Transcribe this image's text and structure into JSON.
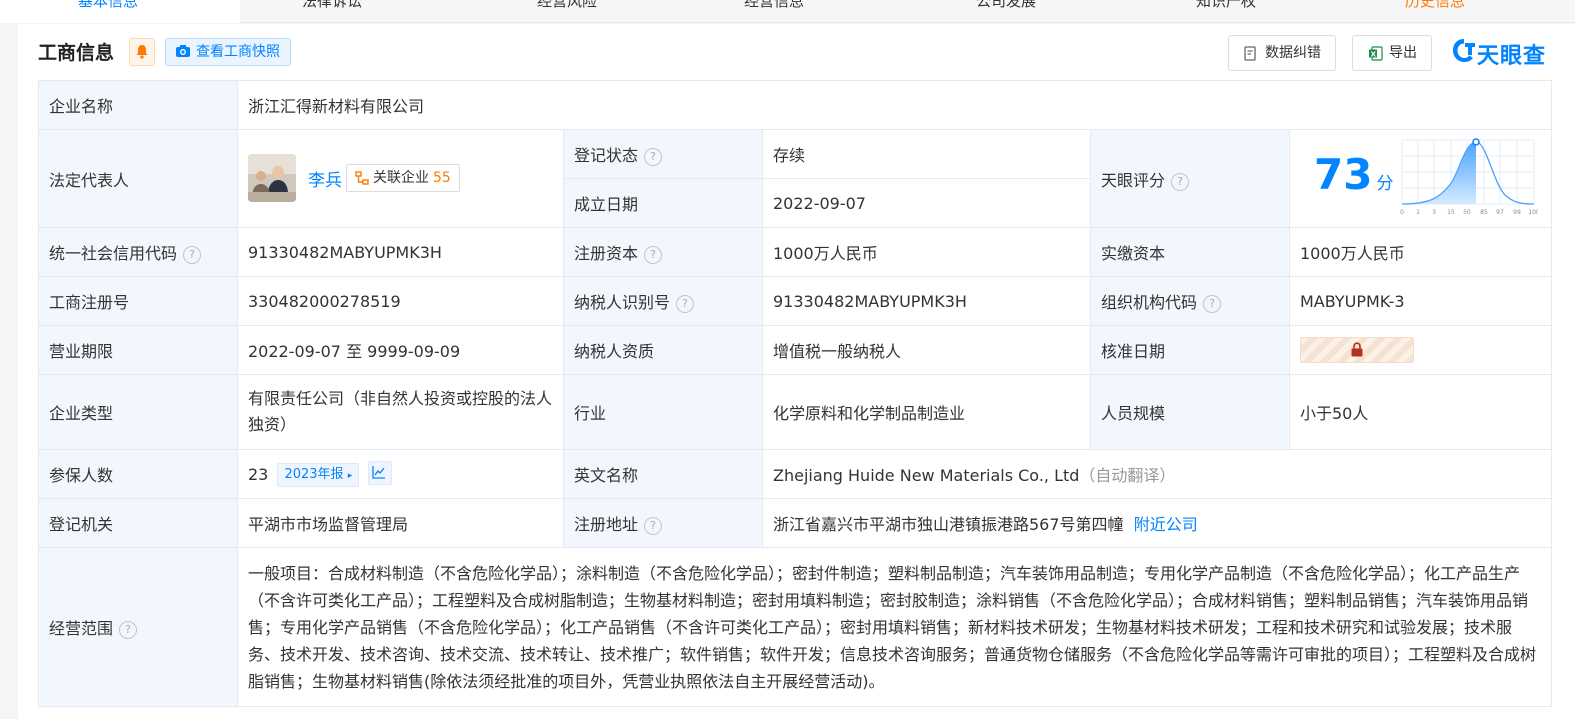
{
  "tabs": [
    {
      "label": "基本信息"
    },
    {
      "label": "法律诉讼"
    },
    {
      "label": "经营风险"
    },
    {
      "label": "经营信息"
    },
    {
      "label": "公司发展"
    },
    {
      "label": "知识产权"
    },
    {
      "label": "历史信息"
    }
  ],
  "header": {
    "title": "工商信息",
    "snapshot_label": "查看工商快照",
    "correct_label": "数据纠错",
    "export_label": "导出",
    "logo_text": "天眼查"
  },
  "company": {
    "name_label": "企业名称",
    "name": "浙江汇得新材料有限公司",
    "legal_rep_label": "法定代表人",
    "legal_rep": "李兵",
    "related_label": "关联企业",
    "related_count": "55",
    "reg_status_label": "登记状态",
    "reg_status": "存续",
    "founded_label": "成立日期",
    "founded": "2022-09-07",
    "score_label": "天眼评分",
    "score": "73",
    "score_unit": "分",
    "score_ticks": [
      "0",
      "1",
      "3",
      "15",
      "50",
      "85",
      "97",
      "99",
      "100"
    ],
    "credit_code_label": "统一社会信用代码",
    "credit_code": "91330482MABYUPMK3H",
    "reg_capital_label": "注册资本",
    "reg_capital": "1000万人民币",
    "paid_capital_label": "实缴资本",
    "paid_capital": "1000万人民币",
    "reg_no_label": "工商注册号",
    "reg_no": "330482000278519",
    "taxpayer_id_label": "纳税人识别号",
    "taxpayer_id": "91330482MABYUPMK3H",
    "org_code_label": "组织机构代码",
    "org_code": "MABYUPMK-3",
    "term_label": "营业期限",
    "term": "2022-09-07 至 9999-09-09",
    "taxpayer_qual_label": "纳税人资质",
    "taxpayer_qual": "增值税一般纳税人",
    "approve_date_label": "核准日期",
    "type_label": "企业类型",
    "type": "有限责任公司（非自然人投资或控股的法人独资）",
    "industry_label": "行业",
    "industry": "化学原料和化学制品制造业",
    "staff_label": "人员规模",
    "staff": "小于50人",
    "insured_label": "参保人数",
    "insured": "23",
    "insured_report": "2023年报",
    "english_label": "英文名称",
    "english": "Zhejiang Huide New Materials Co., Ltd",
    "english_note": "（自动翻译）",
    "authority_label": "登记机关",
    "authority": "平湖市市场监督管理局",
    "address_label": "注册地址",
    "address": "浙江省嘉兴市平湖市独山港镇振港路567号第四幢",
    "nearby_label": "附近公司",
    "scope_label": "经营范围",
    "scope": "一般项目：合成材料制造（不含危险化学品）；涂料制造（不含危险化学品）；密封件制造；塑料制品制造；汽车装饰用品制造；专用化学产品制造（不含危险化学品）；化工产品生产（不含许可类化工产品）；工程塑料及合成树脂制造；生物基材料制造；密封用填料制造；密封胶制造；涂料销售（不含危险化学品）；合成材料销售；塑料制品销售；汽车装饰用品销售；专用化学产品销售（不含危险化学品）；化工产品销售（不含许可类化工产品）；密封用填料销售；新材料技术研发；生物基材料技术研发；工程和技术研究和试验发展；技术服务、技术开发、技术咨询、技术交流、技术转让、技术推广；软件销售；软件开发；信息技术咨询服务；普通货物仓储服务（不含危险化学品等需许可审批的项目）；工程塑料及合成树脂销售；生物基材料销售(除依法须经批准的项目外，凭营业执照依法自主开展经营活动)。"
  },
  "colors": {
    "accent": "#0084ff",
    "status_green": "#22a65b",
    "warn_orange": "#ff7a00",
    "label_bg": "#f2f7fd"
  }
}
